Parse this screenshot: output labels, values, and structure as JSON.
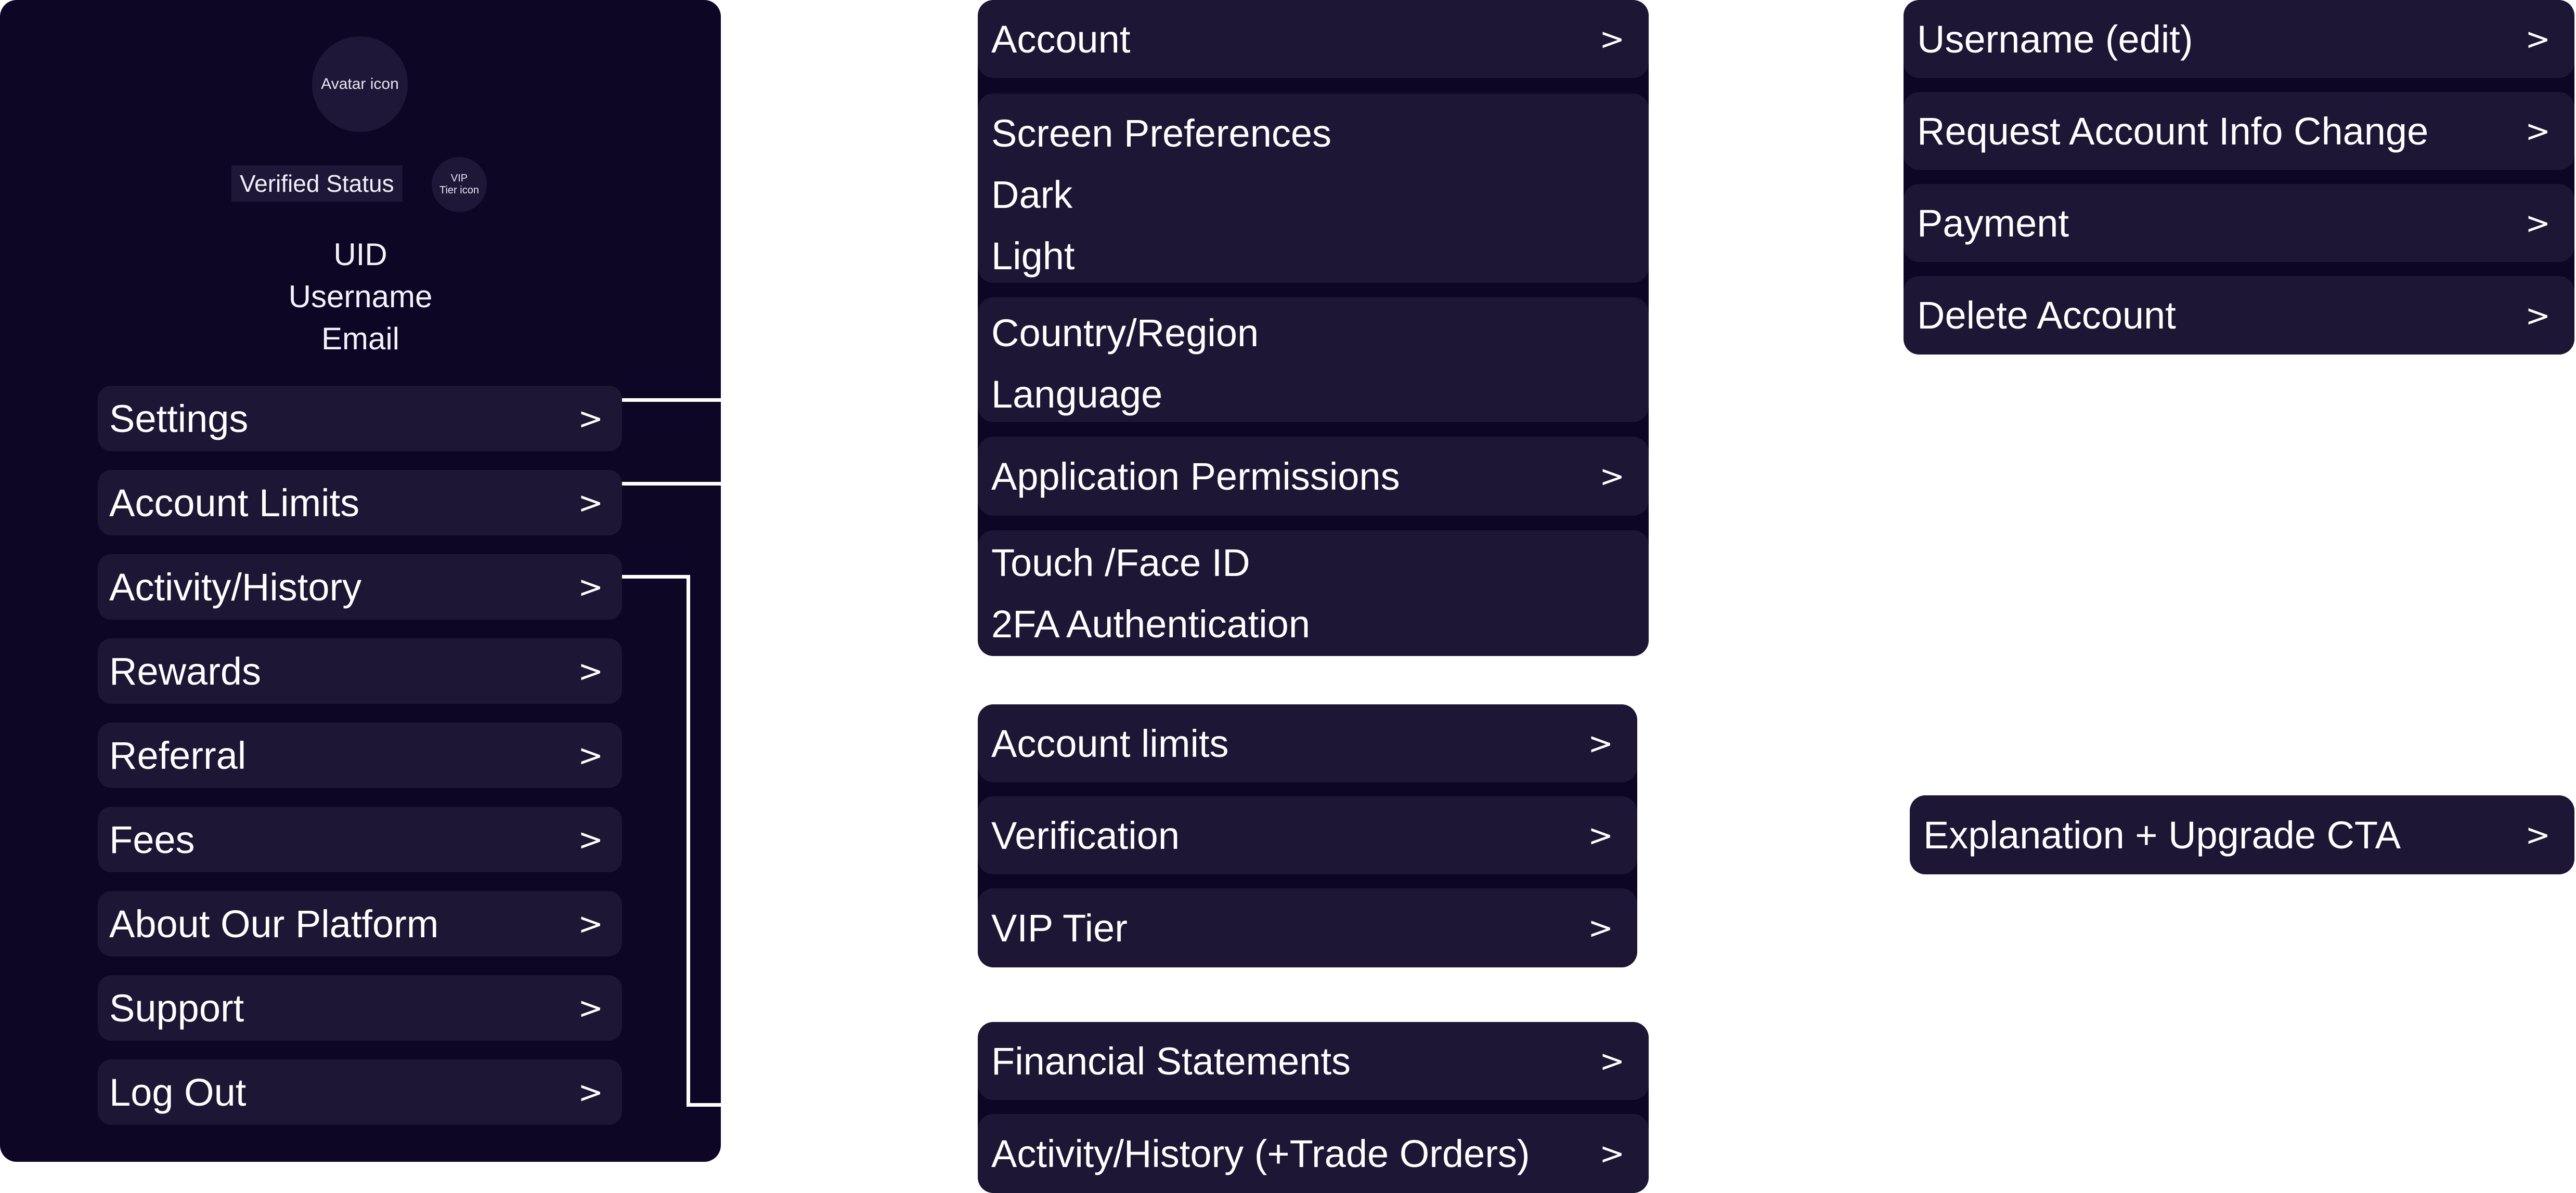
{
  "profile": {
    "avatar_label": "Avatar icon",
    "verified_status": "Verified Status",
    "vip_icon_line1": "VIP",
    "vip_icon_line2": "Tier icon",
    "uid": "UID",
    "username": "Username",
    "email": "Email"
  },
  "menu": [
    {
      "label": "Settings"
    },
    {
      "label": "Account Limits"
    },
    {
      "label": "Activity/History"
    },
    {
      "label": "Rewards"
    },
    {
      "label": "Referral"
    },
    {
      "label": "Fees"
    },
    {
      "label": "About Our Platform"
    },
    {
      "label": "Support"
    },
    {
      "label": "Log Out"
    }
  ],
  "chevron": ">",
  "settings_panel": {
    "account": "Account",
    "screen_prefs": {
      "title": "Screen Preferences",
      "options": [
        "Dark",
        "Light"
      ]
    },
    "locale": {
      "country": "Country/Region",
      "language": "Language"
    },
    "app_permissions": "Application Permissions",
    "security": {
      "touch_face": "Touch /Face ID",
      "twofa": "2FA Authentication"
    }
  },
  "limits_panel": {
    "account_limits": "Account limits",
    "verification": "Verification",
    "vip_tier": "VIP Tier"
  },
  "history_panel": {
    "financial_statements": "Financial Statements",
    "activity_history": "Activity/History (+Trade Orders)"
  },
  "account_panel": {
    "username_edit": "Username (edit)",
    "request_change": "Request Account Info Change",
    "payment": "Payment",
    "delete_account": "Delete Account"
  },
  "upgrade_panel": {
    "explanation": "Explanation + Upgrade CTA"
  },
  "colors": {
    "panel_bg": "#0d0624",
    "row_bg": "#1d1634",
    "text": "#ffffff",
    "connector": "#ffffff"
  }
}
